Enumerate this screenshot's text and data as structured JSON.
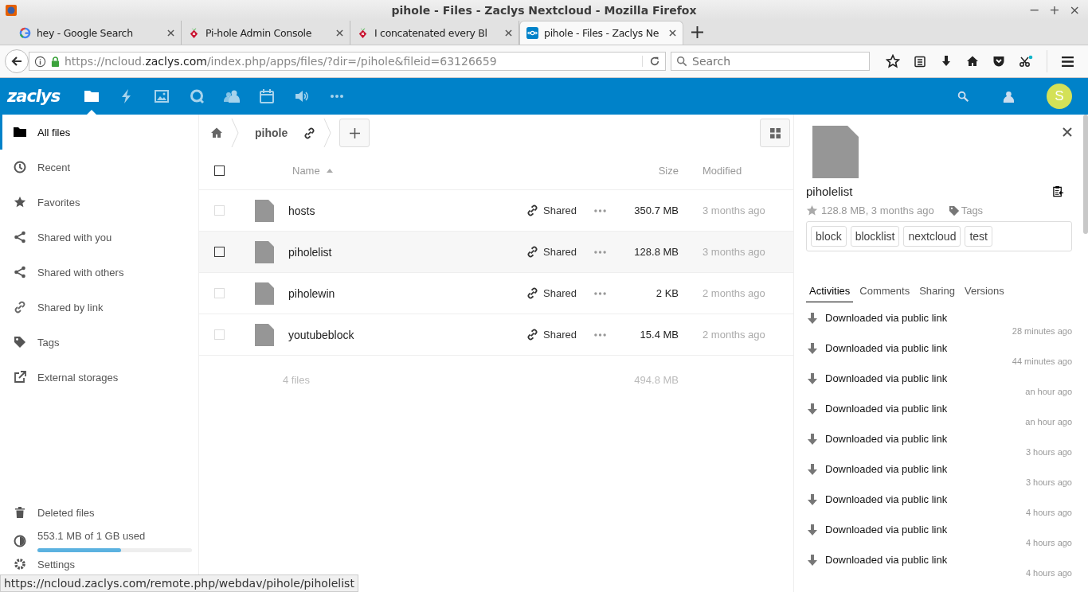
{
  "window": {
    "title": "pihole - Files - Zaclys Nextcloud - Mozilla Firefox",
    "controls": [
      "−",
      "+",
      "×"
    ]
  },
  "browser_tabs": [
    {
      "title": "hey - Google Search",
      "kind": "google",
      "selected": false
    },
    {
      "title": "Pi-hole Admin Console",
      "kind": "pihole",
      "selected": false
    },
    {
      "title": "I concatenated every Bl",
      "kind": "pihole",
      "selected": false
    },
    {
      "title": "pihole - Files - Zaclys Ne",
      "kind": "nextcloud",
      "selected": true
    }
  ],
  "address_bar": {
    "host_prefix": "https://ncloud.",
    "domain": "zaclys.com",
    "path": "/index.php/apps/files/?dir=/pihole&fileid=63126659"
  },
  "search": {
    "placeholder": "Search"
  },
  "app_header": {
    "logo": "zaclys",
    "apps": [
      {
        "kind": "files",
        "selected": true
      },
      {
        "kind": "activity",
        "selected": false
      },
      {
        "kind": "gallery",
        "selected": false
      },
      {
        "kind": "talk",
        "selected": false
      },
      {
        "kind": "contacts",
        "selected": false
      },
      {
        "kind": "calendar",
        "selected": false
      },
      {
        "kind": "audio",
        "selected": false
      },
      {
        "kind": "more",
        "selected": false
      }
    ],
    "avatar": "S"
  },
  "sidebar": {
    "items": [
      {
        "label": "All files",
        "kind": "folder",
        "selected": true
      },
      {
        "label": "Recent",
        "kind": "clock",
        "selected": false
      },
      {
        "label": "Favorites",
        "kind": "star",
        "selected": false
      },
      {
        "label": "Shared with you",
        "kind": "share",
        "selected": false
      },
      {
        "label": "Shared with others",
        "kind": "share",
        "selected": false
      },
      {
        "label": "Shared by link",
        "kind": "link",
        "selected": false
      },
      {
        "label": "Tags",
        "kind": "tag",
        "selected": false
      },
      {
        "label": "External storages",
        "kind": "external",
        "selected": false
      }
    ],
    "deleted": "Deleted files",
    "quota": {
      "text": "553.1 MB of 1 GB used",
      "level": 0.54
    },
    "settings": "Settings"
  },
  "breadcrumb": {
    "folder": "pihole"
  },
  "table": {
    "columns": [
      "Name",
      "Size",
      "Modified"
    ],
    "select_all_checked": false,
    "rows": [
      {
        "name": "hosts",
        "share": "Shared",
        "size": "350.7 MB",
        "modified": "3 months ago",
        "selected": false
      },
      {
        "name": "piholelist",
        "share": "Shared",
        "size": "128.8 MB",
        "modified": "3 months ago",
        "selected": true
      },
      {
        "name": "piholewin",
        "share": "Shared",
        "size": "2 KB",
        "modified": "2 months ago",
        "selected": false
      },
      {
        "name": "youtubeblock",
        "share": "Shared",
        "size": "15.4 MB",
        "modified": "2 months ago",
        "selected": false
      }
    ],
    "summary": {
      "count": "4 files",
      "size": "494.8 MB"
    }
  },
  "details": {
    "file_name": "piholelist",
    "meta": "128.8 MB, 3 months ago",
    "tags_label": "Tags",
    "tags": [
      "block",
      "blocklist",
      "nextcloud",
      "test"
    ],
    "tabs": [
      {
        "label": "Activities",
        "selected": true
      },
      {
        "label": "Comments",
        "selected": false
      },
      {
        "label": "Sharing",
        "selected": false
      },
      {
        "label": "Versions",
        "selected": false
      }
    ],
    "activities": [
      {
        "text": "Downloaded via public link",
        "time": "28 minutes ago"
      },
      {
        "text": "Downloaded via public link",
        "time": "44 minutes ago"
      },
      {
        "text": "Downloaded via public link",
        "time": "an hour ago"
      },
      {
        "text": "Downloaded via public link",
        "time": "an hour ago"
      },
      {
        "text": "Downloaded via public link",
        "time": "3 hours ago"
      },
      {
        "text": "Downloaded via public link",
        "time": "3 hours ago"
      },
      {
        "text": "Downloaded via public link",
        "time": "4 hours ago"
      },
      {
        "text": "Downloaded via public link",
        "time": "4 hours ago"
      },
      {
        "text": "Downloaded via public link",
        "time": "4 hours ago"
      }
    ]
  },
  "status_url": "https://ncloud.zaclys.com/remote.php/webdav/pihole/piholelist"
}
